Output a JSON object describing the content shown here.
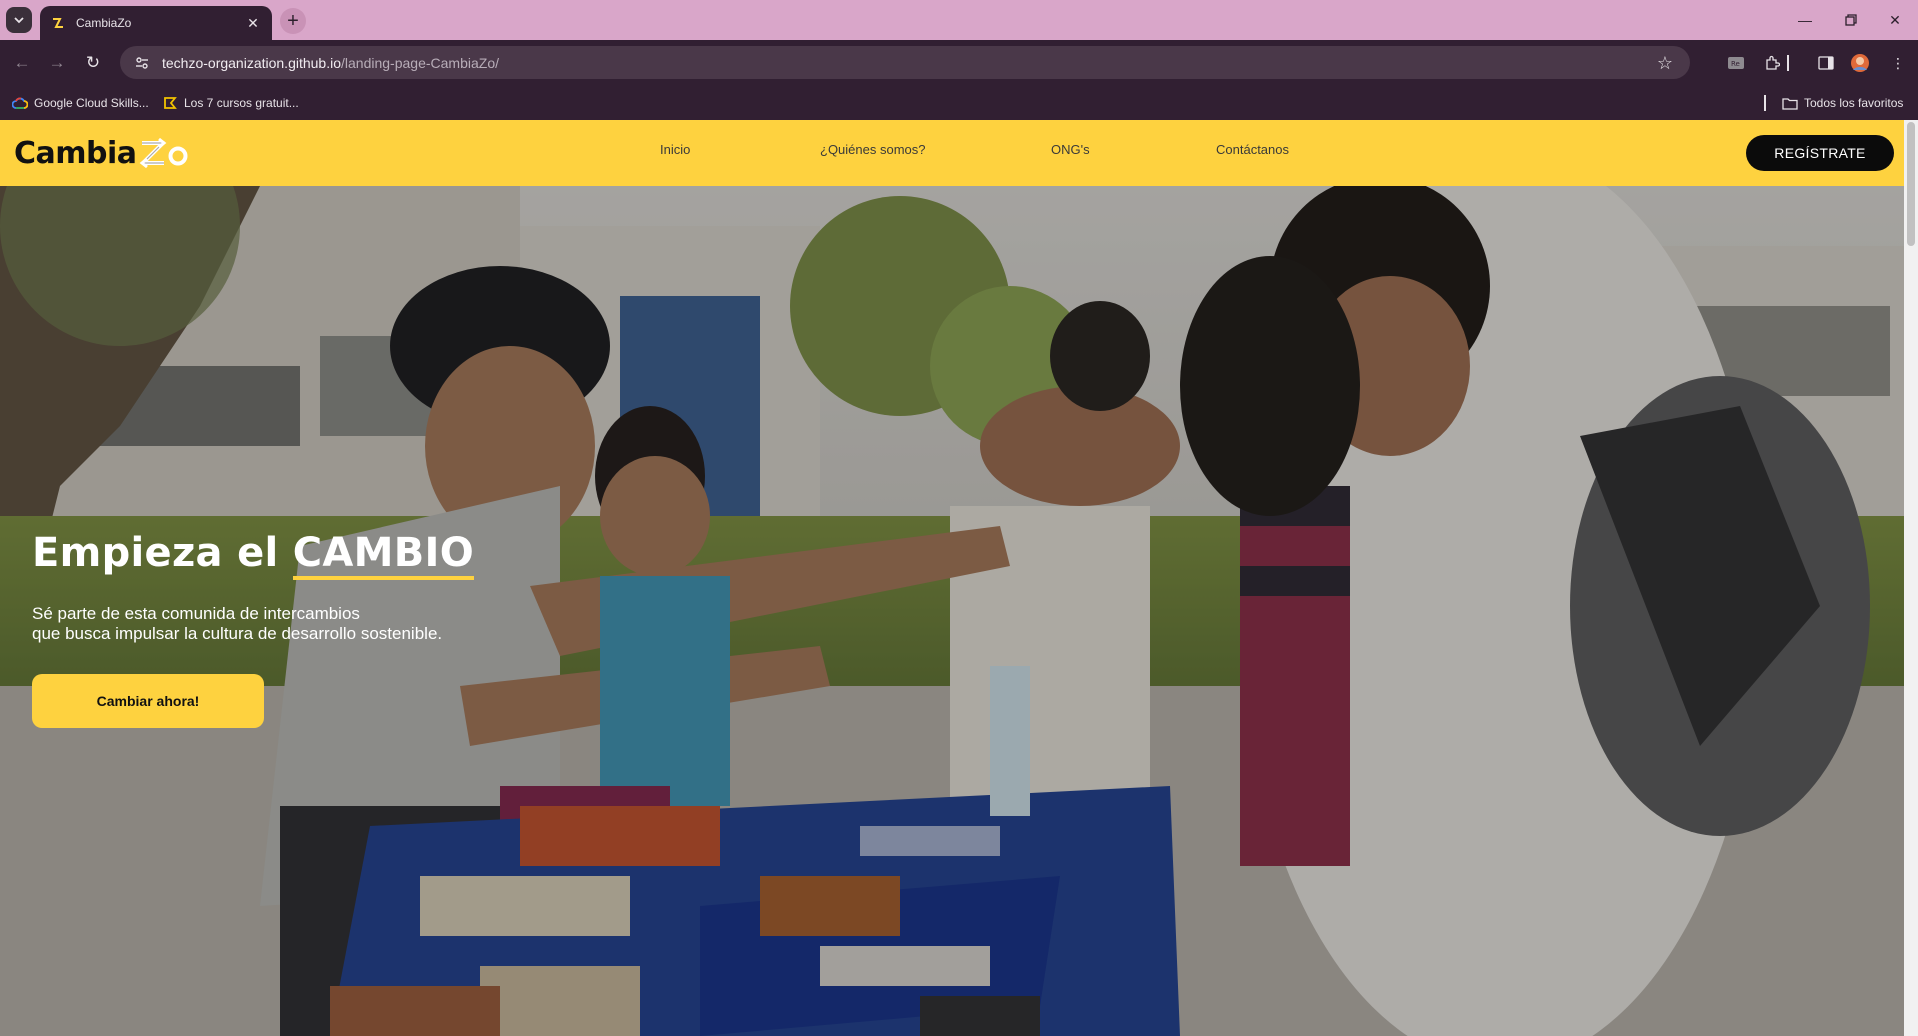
{
  "browser": {
    "tab_title": "CambiaZo",
    "url_domain": "techzo-organization.github.io",
    "url_path": "/landing-page-CambiaZo/",
    "bookmarks": [
      {
        "label": "Google Cloud Skills...",
        "icon": "google-cloud-icon"
      },
      {
        "label": "Los 7 cursos gratuit...",
        "icon": "bookmark-page-icon"
      }
    ],
    "all_bookmarks": "Todos los favoritos",
    "accent_color": "#d9a6c9",
    "toolbar_color": "#311f32"
  },
  "site": {
    "brand_text": "Cambia",
    "brand_color": "#fed23f",
    "nav": [
      "Inicio",
      "¿Quiénes somos?",
      "ONG's",
      "Contáctanos"
    ],
    "register_label": "REGÍSTRATE"
  },
  "hero": {
    "title_prefix": "Empieza el ",
    "title_highlight": "CAMBIO",
    "subtitle_line1": "Sé parte de esta comunida de intercambios",
    "subtitle_line2": "que busca impulsar la cultura de desarrollo sostenible.",
    "cta_label": "Cambiar ahora!"
  }
}
